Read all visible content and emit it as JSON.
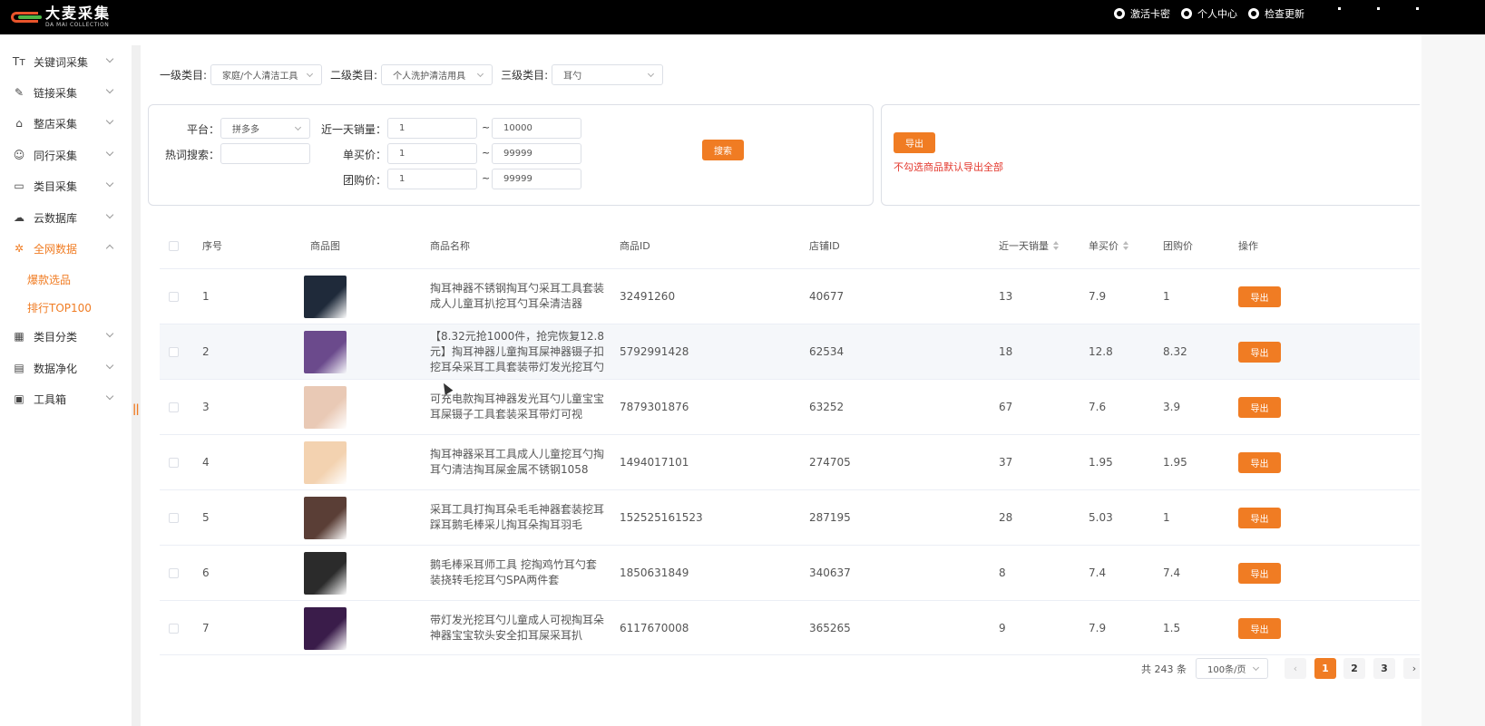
{
  "app": {
    "brand_cn": "大麦采集",
    "brand_en": "DA MAI COLLECTION",
    "top_actions": [
      {
        "label": "激活卡密",
        "icon": "key-icon"
      },
      {
        "label": "个人中心",
        "icon": "user-icon"
      },
      {
        "label": "检查更新",
        "icon": "refresh-icon"
      }
    ]
  },
  "sidebar": {
    "items": [
      {
        "label": "关键词采集",
        "icon": "text-icon",
        "glyph": "Tт"
      },
      {
        "label": "链接采集",
        "icon": "paperclip-icon",
        "glyph": "🔗"
      },
      {
        "label": "整店采集",
        "icon": "store-icon",
        "glyph": "⌂"
      },
      {
        "label": "同行采集",
        "icon": "users-icon",
        "glyph": "☺"
      },
      {
        "label": "类目采集",
        "icon": "inbox-icon",
        "glyph": "▭"
      },
      {
        "label": "云数据库",
        "icon": "cloud-icon",
        "glyph": "☁"
      },
      {
        "label": "全网数据",
        "icon": "gear-icon",
        "glyph": "✲"
      },
      {
        "label": "类目分类",
        "icon": "grid-icon",
        "glyph": "▦"
      },
      {
        "label": "数据净化",
        "icon": "document-icon",
        "glyph": "▤"
      },
      {
        "label": "工具箱",
        "icon": "toolbox-icon",
        "glyph": "▣"
      }
    ],
    "subitems": [
      "爆款选品",
      "排行TOP100"
    ]
  },
  "category_filter": {
    "level1_label": "一级类目:",
    "level1_value": "家庭/个人清洁工具",
    "level2_label": "二级类目:",
    "level2_value": "个人洗护清洁用具",
    "level3_label": "三级类目:",
    "level3_value": "耳勺"
  },
  "search_panel": {
    "platform_label": "平台：",
    "platform_value": "拼多多",
    "hotword_label": "热词搜索：",
    "hotword_value": "",
    "sales_label": "近一天销量：",
    "sales_min": "1",
    "sales_max": "10000",
    "unit_price_label": "单买价：",
    "unit_price_min": "1",
    "unit_price_max": "99999",
    "group_price_label": "团购价：",
    "group_price_min": "1",
    "group_price_max": "99999",
    "tilde": "~",
    "search_button": "搜索"
  },
  "export_panel": {
    "export_button": "导出",
    "hint": "不勾选商品默认导出全部"
  },
  "table": {
    "headers": {
      "index": "序号",
      "image": "商品图",
      "name": "商品名称",
      "product_id": "商品ID",
      "shop_id": "店铺ID",
      "sales": "近一天销量",
      "unit_price": "单买价",
      "group_price": "团购价",
      "action": "操作"
    },
    "export_label": "导出",
    "rows": [
      {
        "index": "1",
        "name": "掏耳神器不锈钢掏耳勺采耳工具套装成人儿童耳扒挖耳勺耳朵清洁器",
        "product_id": "32491260",
        "shop_id": "40677",
        "sales": "13",
        "unit_price": "7.9",
        "group_price": "1",
        "thumb_color": "#1f2a3a"
      },
      {
        "index": "2",
        "name": "【8.32元抢1000件，抢完恢复12.8元】掏耳神器儿童掏耳屎神器镊子扣挖耳朵采耳工具套装带灯发光挖耳勺",
        "product_id": "5792991428",
        "shop_id": "62534",
        "sales": "18",
        "unit_price": "12.8",
        "group_price": "8.32",
        "thumb_color": "#6b4a8c"
      },
      {
        "index": "3",
        "name": "可充电款掏耳神器发光耳勺儿童宝宝耳屎镊子工具套装采耳带灯可视",
        "product_id": "7879301876",
        "shop_id": "63252",
        "sales": "67",
        "unit_price": "7.6",
        "group_price": "3.9",
        "thumb_color": "#e9c9b5"
      },
      {
        "index": "4",
        "name": "掏耳神器采耳工具成人儿童挖耳勺掏耳勺清洁掏耳屎金属不锈钢1058",
        "product_id": "1494017101",
        "shop_id": "274705",
        "sales": "37",
        "unit_price": "1.95",
        "group_price": "1.95",
        "thumb_color": "#f3d2b0"
      },
      {
        "index": "5",
        "name": "采耳工具打掏耳朵毛毛神器套装挖耳踩耳鹅毛棒采儿掏耳朵掏耳羽毛",
        "product_id": "152525161523",
        "shop_id": "287195",
        "sales": "28",
        "unit_price": "5.03",
        "group_price": "1",
        "thumb_color": "#5a3e36"
      },
      {
        "index": "6",
        "name": "鹅毛棒采耳师工具 挖掏鸡竹耳勺套装挠转毛挖耳勺SPA两件套",
        "product_id": "1850631849",
        "shop_id": "340637",
        "sales": "8",
        "unit_price": "7.4",
        "group_price": "7.4",
        "thumb_color": "#2b2b2b"
      },
      {
        "index": "7",
        "name": "带灯发光挖耳勺儿童成人可视掏耳朵神器宝宝软头安全扣耳屎采耳扒",
        "product_id": "6117670008",
        "shop_id": "365265",
        "sales": "9",
        "unit_price": "7.9",
        "group_price": "1.5",
        "thumb_color": "#3a1c4a"
      }
    ]
  },
  "pagination": {
    "total_text": "共 243 条",
    "page_size": "100条/页",
    "pages": [
      "1",
      "2",
      "3"
    ],
    "prev": "‹",
    "next": "›"
  }
}
